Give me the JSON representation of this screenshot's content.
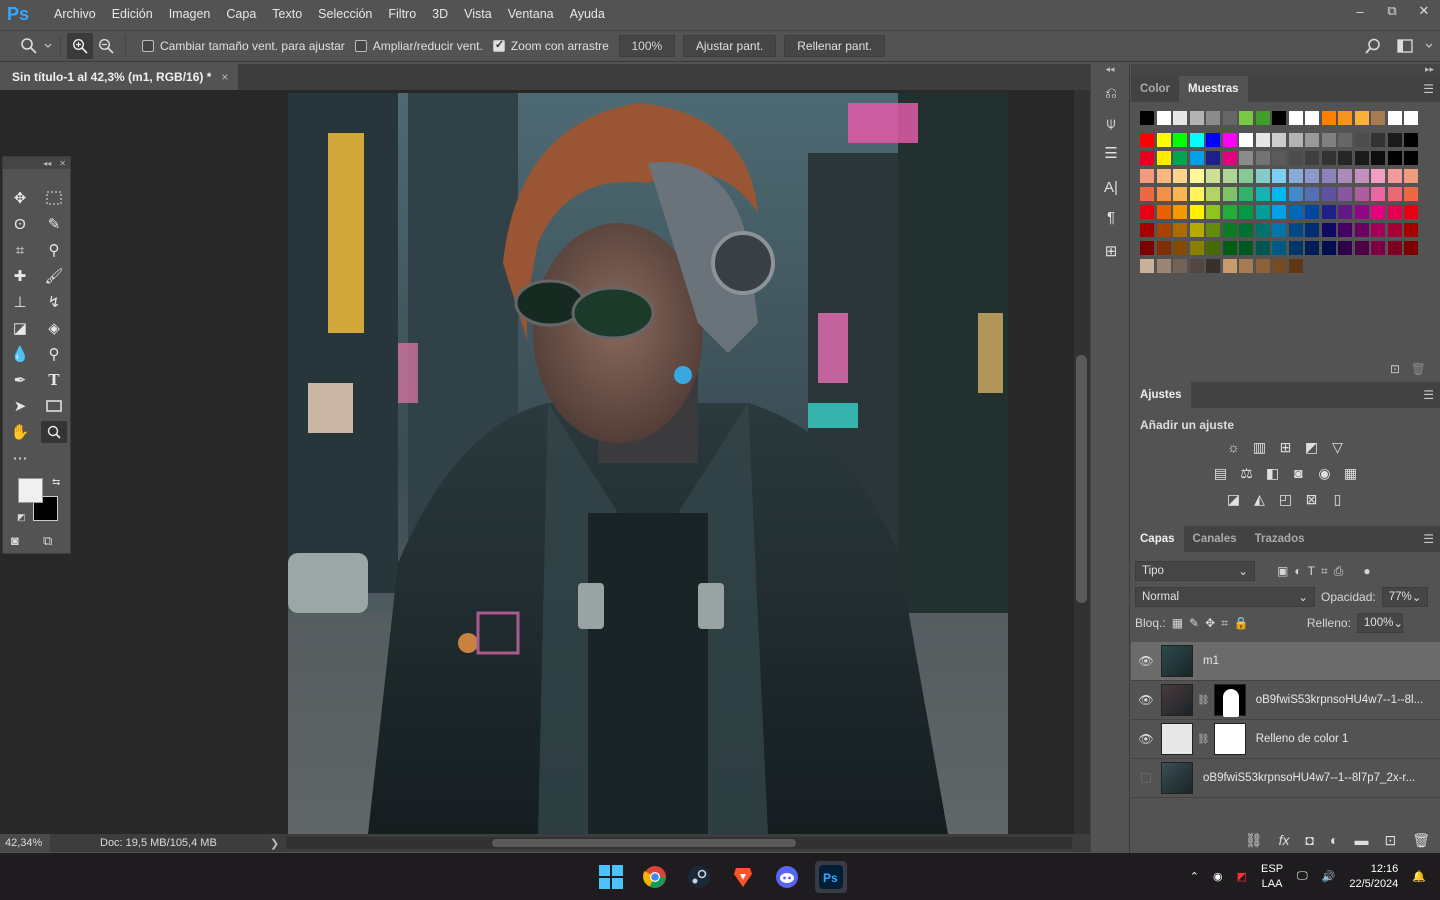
{
  "app": {
    "logo": "Ps"
  },
  "menu": [
    "Archivo",
    "Edición",
    "Imagen",
    "Capa",
    "Texto",
    "Selección",
    "Filtro",
    "3D",
    "Vista",
    "Ventana",
    "Ayuda"
  ],
  "window_controls": {
    "minimize": "–",
    "restore": "⧉",
    "close": "✕"
  },
  "options": {
    "chk_resize": "Cambiar tamaño vent. para ajustar",
    "chk_scale": "Ampliar/reducir vent.",
    "chk_scrubby": "Zoom con arrastre",
    "zoom_value": "100%",
    "fit_btn": "Ajustar pant.",
    "fill_btn": "Rellenar pant."
  },
  "document": {
    "tab_title": "Sin título-1 al 42,3% (m1, RGB/16) *",
    "tab_close": "×"
  },
  "status": {
    "zoom": "42,34%",
    "doc": "Doc: 19,5 MB/105,4 MB",
    "arrow": "❯"
  },
  "panels": {
    "color_tab": "Color",
    "swatches_tab": "Muestras",
    "adjust_tab": "Ajustes",
    "adjust_title": "Añadir un ajuste",
    "layers_tab": "Capas",
    "channels_tab": "Canales",
    "paths_tab": "Trazados",
    "filter_kind": "Tipo",
    "blend_mode": "Normal",
    "opacity_label": "Opacidad:",
    "opacity_value": "77%",
    "lock_label": "Bloq.:",
    "fill_label": "Relleno:",
    "fill_value": "100%"
  },
  "layers": [
    {
      "name": "m1",
      "visible": true,
      "selected": true
    },
    {
      "name": "oB9fwiS53krpnsoHU4w7--1--8l...",
      "visible": true,
      "selected": false
    },
    {
      "name": "Relleno de color 1",
      "visible": true,
      "selected": false
    },
    {
      "name": "oB9fwiS53krpnsoHU4w7--1--8l7p7_2x-r...",
      "visible": false,
      "selected": false
    }
  ],
  "swatch_colors": {
    "row1": [
      "#000000",
      "#ffffff",
      "#e6e6e6",
      "#b3b3b3",
      "#8c8c8c",
      "#666666",
      "#7ac943",
      "#3f9f2a",
      "#000000",
      "#ffffff",
      "#ffffff",
      "#ff7f00",
      "#f7931e",
      "#fbb03b",
      "#a67c52",
      "#ffffff",
      "#ffffff"
    ],
    "grid": [
      [
        "#ff0000",
        "#ffff00",
        "#00ff00",
        "#00ffff",
        "#0000ff",
        "#ff00ff",
        "#ffffff",
        "#e6e6e6",
        "#cccccc",
        "#b3b3b3",
        "#999999",
        "#808080",
        "#666666",
        "#4d4d4d",
        "#333333",
        "#1a1a1a",
        "#000000"
      ],
      [
        "#e6001f",
        "#ffed00",
        "#00a550",
        "#00a0e9",
        "#1d2088",
        "#e4007f",
        "#8c8c8c",
        "#737373",
        "#5a5a5a",
        "#4d4d4d",
        "#404040",
        "#333333",
        "#262626",
        "#1a1a1a",
        "#0d0d0d",
        "#000000",
        "#000000"
      ],
      [
        "#f29c7e",
        "#f8b780",
        "#fdd38b",
        "#fff799",
        "#cce198",
        "#acd598",
        "#89c997",
        "#84ccc9",
        "#7ecef4",
        "#88abda",
        "#8c97cb",
        "#8f82bc",
        "#aa89bd",
        "#c490bf",
        "#f19ec2",
        "#f29b9a",
        "#f29c7e"
      ],
      [
        "#ec6941",
        "#f19149",
        "#f8b551",
        "#fff45c",
        "#b3d465",
        "#80c269",
        "#32b16c",
        "#13b5b1",
        "#00b7ee",
        "#448aca",
        "#556fb5",
        "#5f52a0",
        "#8957a1",
        "#ae5da1",
        "#ea68a2",
        "#eb6877",
        "#ec6941"
      ],
      [
        "#e60012",
        "#eb6100",
        "#f39800",
        "#fff100",
        "#8fc31f",
        "#22ac38",
        "#009944",
        "#009e96",
        "#00a0e9",
        "#0068b7",
        "#00479d",
        "#1d2088",
        "#601986",
        "#920783",
        "#e4007f",
        "#e5004f",
        "#e60012"
      ],
      [
        "#a40000",
        "#a84200",
        "#ac6a00",
        "#b7aa00",
        "#638c0b",
        "#097c25",
        "#007130",
        "#00736d",
        "#0075a9",
        "#004986",
        "#002e73",
        "#100964",
        "#440062",
        "#6a005f",
        "#a4005b",
        "#a40035",
        "#a40000"
      ],
      [
        "#7d0000",
        "#803000",
        "#834d00",
        "#8a8000",
        "#486a00",
        "#005e15",
        "#005824",
        "#005752",
        "#005982",
        "#003567",
        "#001c58",
        "#000d4f",
        "#2e0049",
        "#500047",
        "#7d0043",
        "#7d0022",
        "#7d0000"
      ],
      [
        "#c7b299",
        "#998675",
        "#736357",
        "#534741",
        "#37302c",
        "#c69c6d",
        "#a67c52",
        "#8c6239",
        "#754c24",
        "#603813"
      ]
    ]
  }
}
